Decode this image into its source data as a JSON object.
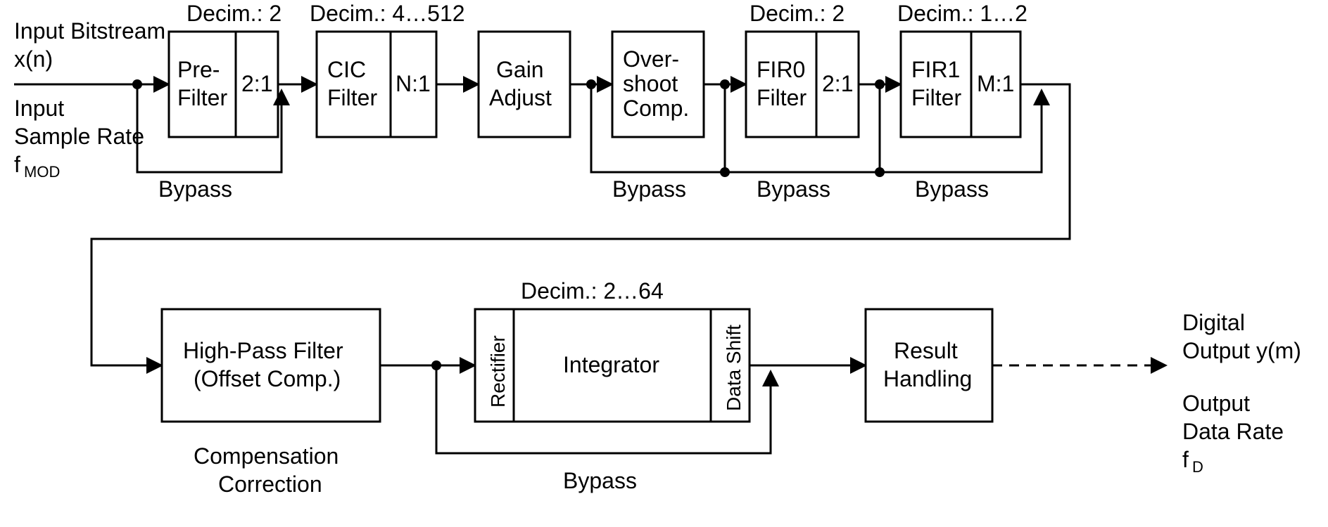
{
  "input": {
    "line1": "Input Bitstream",
    "line2": "x(n)",
    "line3": "Input",
    "line4": "Sample Rate",
    "line5a": "f",
    "line5b": "MOD"
  },
  "output": {
    "line1": "Digital",
    "line2": "Output y(m)",
    "line3": "Output",
    "line4": "Data Rate",
    "line5a": "f",
    "line5b": "D"
  },
  "topRow": {
    "pre": {
      "decim": "Decim.: 2",
      "l1": "Pre-",
      "l2": "Filter",
      "ratio": "2:1"
    },
    "cic": {
      "decim": "Decim.: 4…512",
      "l1": "CIC",
      "l2": "Filter",
      "ratio": "N:1"
    },
    "gain": {
      "l1": "Gain",
      "l2": "Adjust"
    },
    "over": {
      "l1": "Over-",
      "l2": "shoot",
      "l3": "Comp."
    },
    "fir0": {
      "decim": "Decim.: 2",
      "l1": "FIR0",
      "l2": "Filter",
      "ratio": "2:1"
    },
    "fir1": {
      "decim": "Decim.: 1…2",
      "l1": "FIR1",
      "l2": "Filter",
      "ratio": "M:1"
    }
  },
  "bottomRow": {
    "hpf": {
      "l1": "High-Pass Filter",
      "l2": "(Offset Comp.)",
      "cap1": "Compensation",
      "cap2": "Correction"
    },
    "int": {
      "decim": "Decim.: 2…64",
      "rect": "Rectifier",
      "main": "Integrator",
      "shift": "Data Shift"
    },
    "res": {
      "l1": "Result",
      "l2": "Handling"
    }
  },
  "bypass": "Bypass"
}
